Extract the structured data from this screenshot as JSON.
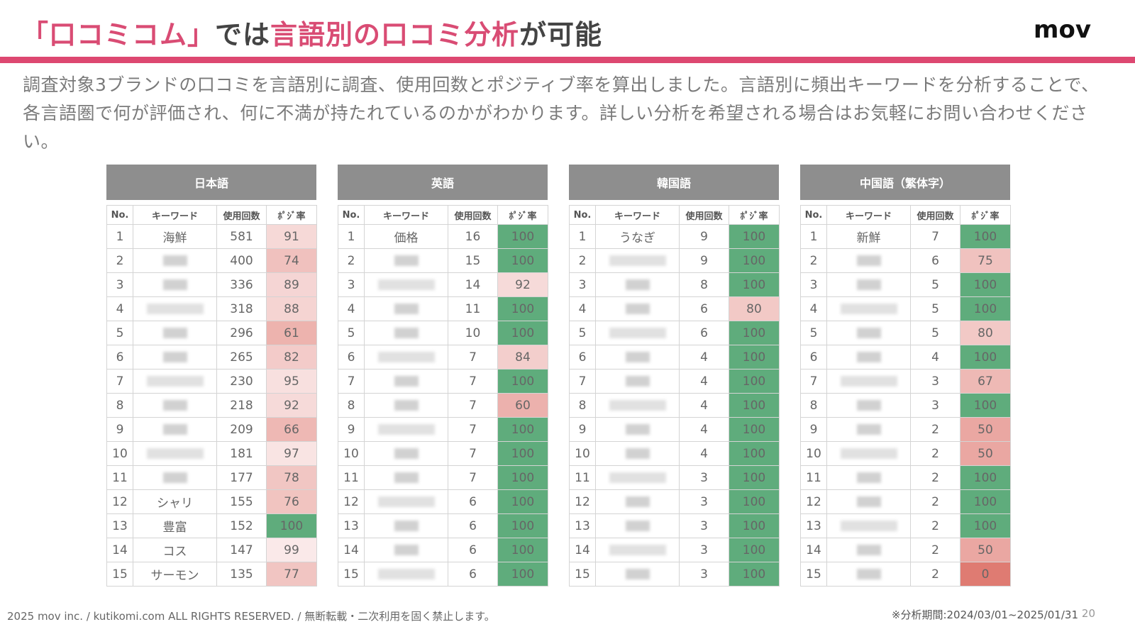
{
  "header": {
    "title_parts": [
      {
        "text": "「口コミコム」",
        "accent": true
      },
      {
        "text": "では",
        "accent": false
      },
      {
        "text": "言語別の口コミ分析",
        "accent": true
      },
      {
        "text": "が可能",
        "accent": false
      }
    ],
    "logo": "mov"
  },
  "intro": "調査対象3ブランドの口コミを言語別に調査、使用回数とポジティブ率を算出しました。言語別に頻出キーワードを分析することで、各言語圏で何が評価され、何に不満が持たれているのかがわかります。詳しい分析を希望される場合はお気軽にお問い合わせください。",
  "colors": {
    "accent": "#dd4871",
    "header_bg": "#8e8e8e",
    "positive_green": "#5fac7c",
    "negative_scale_light": "#fbeeee",
    "negative_scale_dark": "#df7b72"
  },
  "column_headers": {
    "no": "No.",
    "keyword": "キーワード",
    "count": "使用回数",
    "rate": "ﾎﾟｼﾞ率"
  },
  "tables": [
    {
      "language": "日本語",
      "rows": [
        {
          "no": "1",
          "keyword": "海鮮",
          "count": "581",
          "rate": 91
        },
        {
          "no": "2",
          "keyword": "",
          "count": "400",
          "rate": 74
        },
        {
          "no": "3",
          "keyword": "",
          "count": "336",
          "rate": 89
        },
        {
          "no": "4",
          "keyword": "",
          "count": "318",
          "rate": 88
        },
        {
          "no": "5",
          "keyword": "",
          "count": "296",
          "rate": 61
        },
        {
          "no": "6",
          "keyword": "",
          "count": "265",
          "rate": 82
        },
        {
          "no": "7",
          "keyword": "",
          "count": "230",
          "rate": 95
        },
        {
          "no": "8",
          "keyword": "",
          "count": "218",
          "rate": 92
        },
        {
          "no": "9",
          "keyword": "",
          "count": "209",
          "rate": 66
        },
        {
          "no": "10",
          "keyword": "",
          "count": "181",
          "rate": 97
        },
        {
          "no": "11",
          "keyword": "",
          "count": "177",
          "rate": 78
        },
        {
          "no": "12",
          "keyword": "シャリ",
          "count": "155",
          "rate": 76
        },
        {
          "no": "13",
          "keyword": "豊富",
          "count": "152",
          "rate": 100
        },
        {
          "no": "14",
          "keyword": "コス",
          "count": "147",
          "rate": 99
        },
        {
          "no": "15",
          "keyword": "サーモン",
          "count": "135",
          "rate": 77
        }
      ]
    },
    {
      "language": "英語",
      "rows": [
        {
          "no": "1",
          "keyword": "価格",
          "count": "16",
          "rate": 100
        },
        {
          "no": "2",
          "keyword": "",
          "count": "15",
          "rate": 100
        },
        {
          "no": "3",
          "keyword": "",
          "count": "14",
          "rate": 92
        },
        {
          "no": "4",
          "keyword": "",
          "count": "11",
          "rate": 100
        },
        {
          "no": "5",
          "keyword": "",
          "count": "10",
          "rate": 100
        },
        {
          "no": "6",
          "keyword": "",
          "count": "7",
          "rate": 84
        },
        {
          "no": "7",
          "keyword": "",
          "count": "7",
          "rate": 100
        },
        {
          "no": "8",
          "keyword": "",
          "count": "7",
          "rate": 60
        },
        {
          "no": "9",
          "keyword": "",
          "count": "7",
          "rate": 100
        },
        {
          "no": "10",
          "keyword": "",
          "count": "7",
          "rate": 100
        },
        {
          "no": "11",
          "keyword": "",
          "count": "7",
          "rate": 100
        },
        {
          "no": "12",
          "keyword": "",
          "count": "6",
          "rate": 100
        },
        {
          "no": "13",
          "keyword": "",
          "count": "6",
          "rate": 100
        },
        {
          "no": "14",
          "keyword": "",
          "count": "6",
          "rate": 100
        },
        {
          "no": "15",
          "keyword": "",
          "count": "6",
          "rate": 100
        }
      ]
    },
    {
      "language": "韓国語",
      "rows": [
        {
          "no": "1",
          "keyword": "うなぎ",
          "count": "9",
          "rate": 100
        },
        {
          "no": "2",
          "keyword": "",
          "count": "9",
          "rate": 100
        },
        {
          "no": "3",
          "keyword": "",
          "count": "8",
          "rate": 100
        },
        {
          "no": "4",
          "keyword": "",
          "count": "6",
          "rate": 80
        },
        {
          "no": "5",
          "keyword": "",
          "count": "6",
          "rate": 100
        },
        {
          "no": "6",
          "keyword": "",
          "count": "4",
          "rate": 100
        },
        {
          "no": "7",
          "keyword": "",
          "count": "4",
          "rate": 100
        },
        {
          "no": "8",
          "keyword": "",
          "count": "4",
          "rate": 100
        },
        {
          "no": "9",
          "keyword": "",
          "count": "4",
          "rate": 100
        },
        {
          "no": "10",
          "keyword": "",
          "count": "4",
          "rate": 100
        },
        {
          "no": "11",
          "keyword": "",
          "count": "3",
          "rate": 100
        },
        {
          "no": "12",
          "keyword": "",
          "count": "3",
          "rate": 100
        },
        {
          "no": "13",
          "keyword": "",
          "count": "3",
          "rate": 100
        },
        {
          "no": "14",
          "keyword": "",
          "count": "3",
          "rate": 100
        },
        {
          "no": "15",
          "keyword": "",
          "count": "3",
          "rate": 100
        }
      ]
    },
    {
      "language": "中国語（繁体字）",
      "rows": [
        {
          "no": "1",
          "keyword": "新鮮",
          "count": "7",
          "rate": 100
        },
        {
          "no": "2",
          "keyword": "",
          "count": "6",
          "rate": 75
        },
        {
          "no": "3",
          "keyword": "",
          "count": "5",
          "rate": 100
        },
        {
          "no": "4",
          "keyword": "",
          "count": "5",
          "rate": 100
        },
        {
          "no": "5",
          "keyword": "",
          "count": "5",
          "rate": 80
        },
        {
          "no": "6",
          "keyword": "",
          "count": "4",
          "rate": 100
        },
        {
          "no": "7",
          "keyword": "",
          "count": "3",
          "rate": 67
        },
        {
          "no": "8",
          "keyword": "",
          "count": "3",
          "rate": 100
        },
        {
          "no": "9",
          "keyword": "",
          "count": "2",
          "rate": 50
        },
        {
          "no": "10",
          "keyword": "",
          "count": "2",
          "rate": 50
        },
        {
          "no": "11",
          "keyword": "",
          "count": "2",
          "rate": 100
        },
        {
          "no": "12",
          "keyword": "",
          "count": "2",
          "rate": 100
        },
        {
          "no": "13",
          "keyword": "",
          "count": "2",
          "rate": 100
        },
        {
          "no": "14",
          "keyword": "",
          "count": "2",
          "rate": 50
        },
        {
          "no": "15",
          "keyword": "",
          "count": "2",
          "rate": 0
        }
      ]
    }
  ],
  "footer": {
    "copyright": "2025 mov inc. / kutikomi.com ALL RIGHTS RESERVED. / 無断転載・二次利用を固く禁止します。",
    "period": "※分析期間:2024/03/01~2025/01/31",
    "page": "20"
  }
}
